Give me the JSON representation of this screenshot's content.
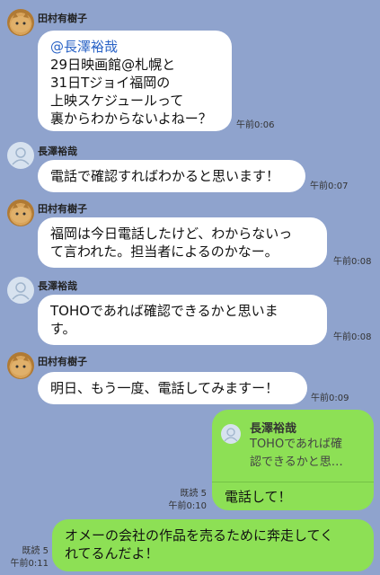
{
  "messages": [
    {
      "name": "田村有樹子",
      "mention": "@長澤裕哉",
      "line1": "29日映画館@札幌と",
      "line2": "31日Tジョイ福岡の",
      "line3": "上映スケジュールって",
      "line4": "裏からわからないよねー？",
      "time": "午前0:06"
    },
    {
      "name": "長澤裕哉",
      "text": "電話で確認すればわかると思います！",
      "time": "午前0:07"
    },
    {
      "name": "田村有樹子",
      "line1": "福岡は今日電話したけど、わからないっ",
      "line2": "て言われた。担当者によるのかなー。",
      "time": "午前0:08"
    },
    {
      "name": "長澤裕哉",
      "line1": "TOHOであれば確認できるかと思いま",
      "line2": "す。",
      "time": "午前0:08"
    },
    {
      "name": "田村有樹子",
      "text": "明日、もう一度、電話してみますー！",
      "time": "午前0:09"
    },
    {
      "quote_name": "長澤裕哉",
      "quote_line1": "TOHOであれば確",
      "quote_line2": "認できるかと思…",
      "text": "電話して！",
      "read": "既読 5",
      "time": "午前0:10"
    },
    {
      "line1": "オメーの会社の作品を売るために奔走してく",
      "line2": "れてるんだよ！",
      "read": "既読 5",
      "time": "午前0:11"
    }
  ]
}
